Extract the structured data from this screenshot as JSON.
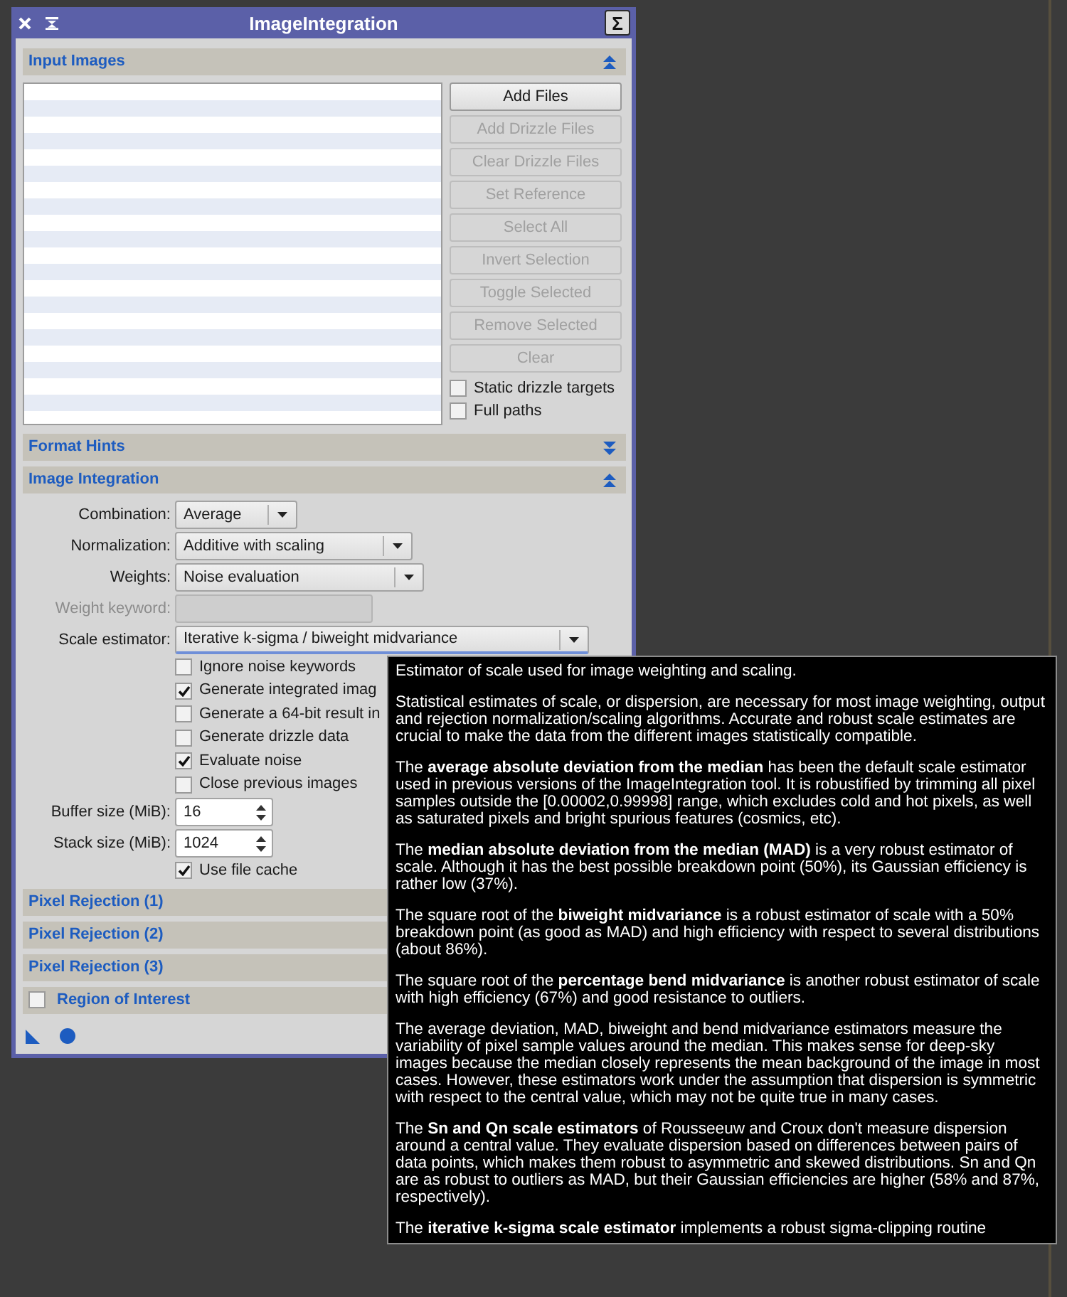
{
  "window": {
    "title": "ImageIntegration",
    "sigma_button": "Σ"
  },
  "sections": [
    {
      "kind": "input_images",
      "title": "Input Images",
      "expanded": true,
      "buttons": [
        {
          "label": "Add Files",
          "disabled": false
        },
        {
          "label": "Add Drizzle Files",
          "disabled": true
        },
        {
          "label": "Clear Drizzle Files",
          "disabled": true
        },
        {
          "label": "Set Reference",
          "disabled": true
        },
        {
          "label": "Select All",
          "disabled": true
        },
        {
          "label": "Invert Selection",
          "disabled": true
        },
        {
          "label": "Toggle Selected",
          "disabled": true
        },
        {
          "label": "Remove Selected",
          "disabled": true
        },
        {
          "label": "Clear",
          "disabled": true
        }
      ],
      "options": [
        {
          "label": "Static drizzle targets",
          "checked": false
        },
        {
          "label": "Full paths",
          "checked": false
        }
      ]
    },
    {
      "kind": "header",
      "title": "Format Hints",
      "expanded": false
    },
    {
      "kind": "image_integration",
      "title": "Image Integration",
      "expanded": true,
      "rows": [
        {
          "kind": "combo",
          "label": "Combination:",
          "value": "Average",
          "focused": false
        },
        {
          "kind": "combo",
          "label": "Normalization:",
          "value": "Additive with scaling",
          "focused": false
        },
        {
          "kind": "combo",
          "label": "Weights:",
          "value": "Noise evaluation",
          "focused": false
        },
        {
          "kind": "text",
          "label": "Weight keyword:",
          "disabled": true
        },
        {
          "kind": "combo",
          "label": "Scale estimator:",
          "value": "Iterative k-sigma / biweight midvariance",
          "focused": true
        },
        {
          "kind": "checkbox",
          "label": "Ignore noise keywords",
          "checked": false
        },
        {
          "kind": "checkbox",
          "label": "Generate integrated imag",
          "checked": true
        },
        {
          "kind": "checkbox",
          "label": "Generate a 64-bit result in",
          "checked": false
        },
        {
          "kind": "checkbox",
          "label": "Generate drizzle data",
          "checked": false
        },
        {
          "kind": "checkbox",
          "label": "Evaluate noise",
          "checked": true
        },
        {
          "kind": "checkbox",
          "label": "Close previous images",
          "checked": false
        },
        {
          "kind": "spin",
          "label": "Buffer size (MiB):",
          "value": "16"
        },
        {
          "kind": "spin",
          "label": "Stack size (MiB):",
          "value": "1024"
        },
        {
          "kind": "checkbox",
          "label": "Use file cache",
          "checked": true
        }
      ]
    },
    {
      "kind": "header",
      "title": "Pixel Rejection (1)"
    },
    {
      "kind": "header",
      "title": "Pixel Rejection (2)"
    },
    {
      "kind": "header",
      "title": "Pixel Rejection (3)"
    },
    {
      "kind": "roi",
      "title": "Region of Interest",
      "checked": false
    }
  ],
  "tooltip": {
    "paragraphs": [
      "Estimator of scale used for image weighting and scaling.",
      "Statistical estimates of scale, or dispersion, are necessary for most image weighting, output and rejection normalization/scaling algorithms. Accurate and robust scale estimates are crucial to make the data from the different images statistically compatible.",
      "The **average absolute deviation from the median** has been the default scale estimator used in previous versions of the ImageIntegration tool. It is robustified by trimming all pixel samples outside the [0.00002,0.99998] range, which excludes cold and hot pixels, as well as saturated pixels and bright spurious features (cosmics, etc).",
      "The **median absolute deviation from the median (MAD)** is a very robust estimator of scale. Although it has the best possible breakdown point (50%), its Gaussian efficiency is rather low (37%).",
      "The square root of the **biweight midvariance** is a robust estimator of scale with a 50% breakdown point (as good as MAD) and high efficiency with respect to several distributions (about 86%).",
      "The square root of the **percentage bend midvariance** is another robust estimator of scale with high efficiency (67%) and good resistance to outliers.",
      "The average deviation, MAD, biweight and bend midvariance estimators measure the variability of pixel sample values around the median. This makes sense for deep-sky images because the median closely represents the mean background of the image in most cases. However, these estimators work under the assumption that dispersion is symmetric with respect to the central value, which may not be quite true in many cases.",
      "The **Sn and Qn scale estimators** of Rousseeuw and Croux don't measure dispersion around a central value. They evaluate dispersion based on differences between pairs of data points, which makes them robust to asymmetric and skewed distributions. Sn and Qn are as robust to outliers as MAD, but their Gaussian efficiencies are higher (58% and 87%, respectively).",
      "The **iterative k-sigma scale estimator** implements a robust sigma-clipping routine"
    ]
  }
}
